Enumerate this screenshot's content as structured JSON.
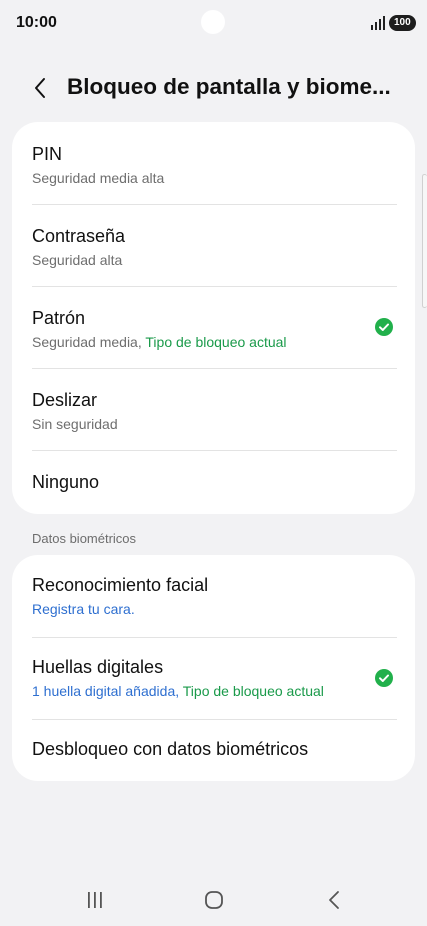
{
  "status": {
    "time": "10:00",
    "battery": "100"
  },
  "header": {
    "title": "Bloqueo de pantalla y biome..."
  },
  "lock_options": [
    {
      "title": "PIN",
      "subtitle": "Seguridad media alta"
    },
    {
      "title": "Contraseña",
      "subtitle": "Seguridad alta"
    },
    {
      "title": "Patrón",
      "subtitle": "Seguridad media,",
      "badge": "Tipo de bloqueo actual"
    },
    {
      "title": "Deslizar",
      "subtitle": "Sin seguridad"
    },
    {
      "title": "Ninguno"
    }
  ],
  "biometrics": {
    "section_label": "Datos biométricos",
    "items": [
      {
        "title": "Reconocimiento facial",
        "subtitle": "Registra tu cara."
      },
      {
        "title": "Huellas digitales",
        "subtitle": "1 huella digital añadida,",
        "badge": "Tipo de bloqueo actual"
      },
      {
        "title": "Desbloqueo con datos biométricos"
      }
    ]
  },
  "colors": {
    "accent_green": "#1a9a4a",
    "link_blue": "#2e6fd0",
    "check_green": "#21b04b"
  },
  "icons": {
    "back": "chevron-left-icon",
    "check": "check-circle-icon",
    "nav_recents": "recents-icon",
    "nav_home": "home-icon",
    "nav_back": "back-icon"
  }
}
